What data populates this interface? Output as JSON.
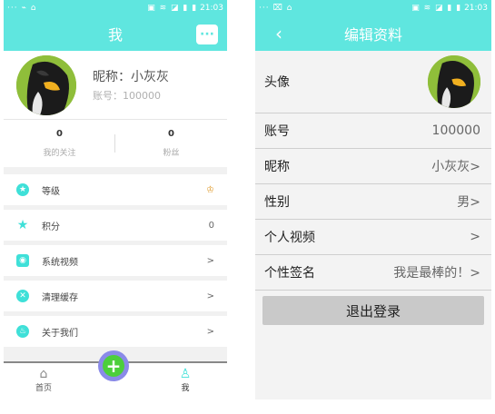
{
  "left": {
    "status": {
      "left_icons": "··· ⌁ ⌂",
      "right_icons": "▣ ≋ ◪ ▮ ▮",
      "time": "21:03"
    },
    "title": "我",
    "chat_icon": "chat-bubble-icon",
    "profile": {
      "nickname": "昵称：小灰灰",
      "account": "账号：100000"
    },
    "stats": [
      {
        "num": "0",
        "label": "我的关注"
      },
      {
        "num": "0",
        "label": "粉丝"
      }
    ],
    "menu": [
      {
        "label": "等级",
        "value": "♔",
        "icon": "star-icon"
      },
      {
        "label": "积分",
        "value": "0",
        "icon": "star-icon"
      },
      {
        "label": "系统视频",
        "value": ">",
        "icon": "camera-icon"
      },
      {
        "label": "清理缓存",
        "value": ">",
        "icon": "clear-icon"
      },
      {
        "label": "关于我们",
        "value": ">",
        "icon": "flame-icon"
      }
    ],
    "nav": {
      "home": "首页",
      "me": "我"
    }
  },
  "right": {
    "status": {
      "left_icons": "··· ⌧ ⌂",
      "right_icons": "▣ ≋ ◪ ▮ ▮",
      "time": "21:03"
    },
    "title": "编辑资料",
    "rows": [
      {
        "label": "账号",
        "value": "100000"
      },
      {
        "label": "昵称",
        "value": "小灰灰>"
      },
      {
        "label": "性别",
        "value": "男>"
      },
      {
        "label": "个人视频",
        "value": ">"
      },
      {
        "label": "个性签名",
        "value": "我是最棒的！>"
      }
    ],
    "avatar_label": "头像",
    "logout": "退出登录"
  }
}
